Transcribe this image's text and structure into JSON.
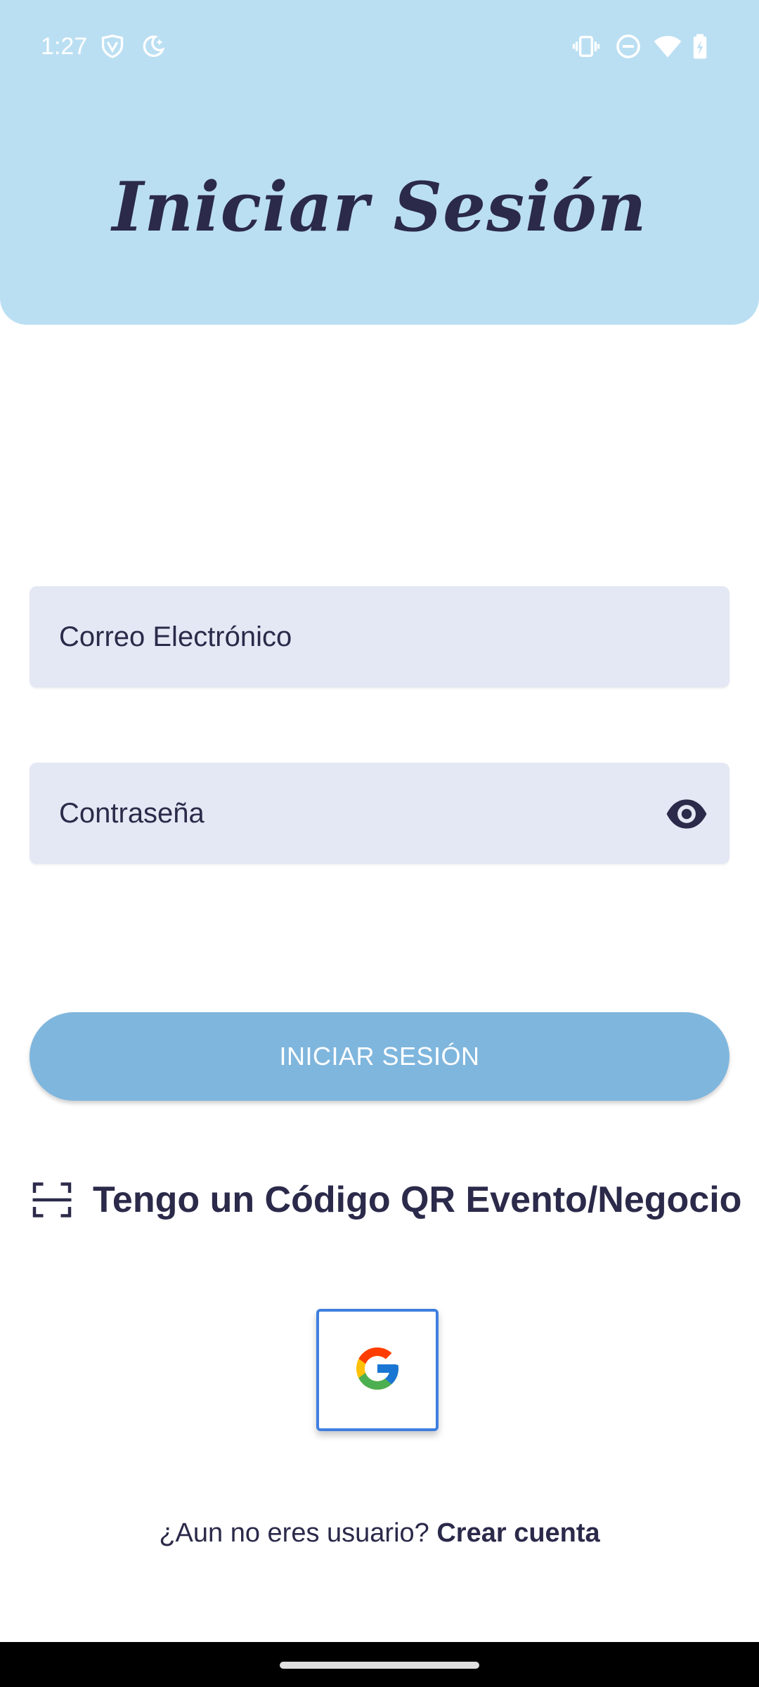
{
  "status_bar": {
    "time": "1:27",
    "left_icons": [
      "shield-v-icon",
      "moon-stars-icon"
    ],
    "right_icons": [
      "vibrate-icon",
      "do-not-disturb-icon",
      "wifi-icon",
      "battery-charging-icon"
    ]
  },
  "header": {
    "title": "Iniciar Sesión",
    "background_color": "#bbdff2"
  },
  "form": {
    "email_placeholder": "Correo Electrónico",
    "password_placeholder": "Contraseña",
    "password_visibility_icon": "eye-icon",
    "login_button_label": "INICIAR SESIÓN",
    "login_button_color": "#7fb6dd"
  },
  "qr": {
    "label": "Tengo un Código QR Evento/Negocio",
    "icon": "qr-scan-icon"
  },
  "google": {
    "icon": "google-logo-icon"
  },
  "footer": {
    "prompt": "¿Aun no eres usuario?",
    "link": "Crear cuenta"
  },
  "colors": {
    "text_dark": "#2b2a4a",
    "field_bg": "#e4e8f4"
  }
}
